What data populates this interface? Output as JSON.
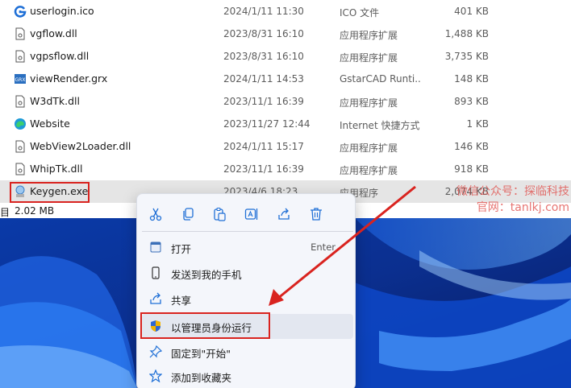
{
  "files": [
    {
      "icon": "ico-file-icon",
      "name": "userlogin.ico",
      "date": "2024/1/11 11:30",
      "type": "ICO 文件",
      "size": "401 KB"
    },
    {
      "icon": "dll-file-icon",
      "name": "vgflow.dll",
      "date": "2023/8/31 16:10",
      "type": "应用程序扩展",
      "size": "1,488 KB"
    },
    {
      "icon": "dll-file-icon",
      "name": "vgpsflow.dll",
      "date": "2023/8/31 16:10",
      "type": "应用程序扩展",
      "size": "3,735 KB"
    },
    {
      "icon": "grx-file-icon",
      "name": "viewRender.grx",
      "date": "2024/1/11 14:53",
      "type": "GstarCAD Runti...",
      "size": "148 KB"
    },
    {
      "icon": "dll-file-icon",
      "name": "W3dTk.dll",
      "date": "2023/11/1 16:39",
      "type": "应用程序扩展",
      "size": "893 KB"
    },
    {
      "icon": "edge-shortcut-icon",
      "name": "Website",
      "date": "2023/11/27 12:44",
      "type": "Internet 快捷方式",
      "size": "1 KB"
    },
    {
      "icon": "dll-file-icon",
      "name": "WebView2Loader.dll",
      "date": "2024/1/11 15:17",
      "type": "应用程序扩展",
      "size": "146 KB"
    },
    {
      "icon": "dll-file-icon",
      "name": "WhipTk.dll",
      "date": "2023/11/1 16:39",
      "type": "应用程序扩展",
      "size": "918 KB"
    },
    {
      "icon": "exe-file-icon",
      "name": "Keygen.exe",
      "date": "2023/4/6 18:23",
      "type": "应用程序",
      "size": "2,074 KB"
    }
  ],
  "status_bar": {
    "items_label": "目",
    "selected_size": "2.02 MB"
  },
  "watermark": {
    "line1": "微信公众号：探临科技",
    "line2": "官网：tanlkj.com"
  },
  "context_menu": {
    "quick_actions": [
      "cut-icon",
      "copy-icon",
      "paste-icon",
      "rename-icon",
      "share-icon",
      "delete-icon"
    ],
    "items": [
      {
        "icon": "open-icon",
        "label": "打开",
        "shortcut": "Enter"
      },
      {
        "icon": "phone-icon",
        "label": "发送到我的手机",
        "shortcut": ""
      },
      {
        "icon": "share-icon",
        "label": "共享",
        "shortcut": ""
      },
      {
        "icon": "shield-icon",
        "label": "以管理员身份运行",
        "shortcut": ""
      },
      {
        "icon": "pin-icon",
        "label": "固定到\"开始\"",
        "shortcut": ""
      },
      {
        "icon": "star-icon",
        "label": "添加到收藏夹",
        "shortcut": ""
      }
    ]
  },
  "colors": {
    "highlight_red": "#d9231f",
    "accent_blue": "#1f6fd6"
  }
}
